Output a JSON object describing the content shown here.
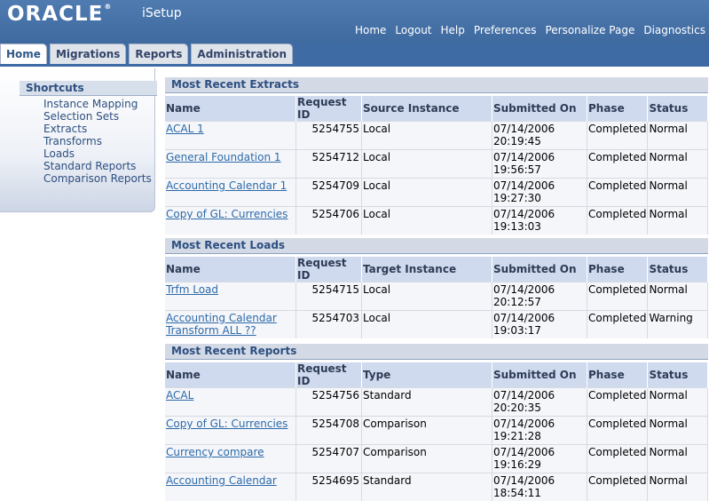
{
  "app": {
    "logo": "ORACLE",
    "subtitle": "iSetup"
  },
  "global_links": [
    "Home",
    "Logout",
    "Help",
    "Preferences",
    "Personalize Page",
    "Diagnostics"
  ],
  "tabs": [
    "Home",
    "Migrations",
    "Reports",
    "Administration"
  ],
  "sidebar": {
    "title": "Shortcuts",
    "items": [
      "Instance Mapping",
      "Selection Sets",
      "Extracts",
      "Transforms",
      "Loads",
      "Standard Reports",
      "Comparison Reports"
    ]
  },
  "extracts": {
    "title": "Most Recent Extracts",
    "headers": [
      "Name",
      "Request ID",
      "Source Instance",
      "Submitted On",
      "Phase",
      "Status"
    ],
    "rows": [
      {
        "name": "ACAL 1",
        "request_id": "5254755",
        "instance": "Local",
        "date": "07/14/2006",
        "time": "20:19:45",
        "phase": "Completed",
        "status": "Normal"
      },
      {
        "name": "General Foundation 1",
        "request_id": "5254712",
        "instance": "Local",
        "date": "07/14/2006",
        "time": "19:56:57",
        "phase": "Completed",
        "status": "Normal"
      },
      {
        "name": "Accounting Calendar 1",
        "request_id": "5254709",
        "instance": "Local",
        "date": "07/14/2006",
        "time": "19:27:30",
        "phase": "Completed",
        "status": "Normal"
      },
      {
        "name": "Copy of GL: Currencies",
        "request_id": "5254706",
        "instance": "Local",
        "date": "07/14/2006",
        "time": "19:13:03",
        "phase": "Completed",
        "status": "Normal"
      }
    ]
  },
  "loads": {
    "title": "Most Recent Loads",
    "headers": [
      "Name",
      "Request ID",
      "Target Instance",
      "Submitted On",
      "Phase",
      "Status"
    ],
    "rows": [
      {
        "name": "Trfm Load",
        "name2": "",
        "request_id": "5254715",
        "instance": "Local",
        "date": "07/14/2006",
        "time": "20:12:57",
        "phase": "Completed",
        "status": "Normal"
      },
      {
        "name": "Accounting Calendar",
        "name2": "Transform ALL ??",
        "request_id": "5254703",
        "instance": "Local",
        "date": "07/14/2006",
        "time": "19:03:17",
        "phase": "Completed",
        "status": "Warning"
      }
    ]
  },
  "reports": {
    "title": "Most Recent Reports",
    "headers": [
      "Name",
      "Request ID",
      "Type",
      "Submitted On",
      "Phase",
      "Status"
    ],
    "rows": [
      {
        "name": "ACAL",
        "request_id": "5254756",
        "type": "Standard",
        "date": "07/14/2006",
        "time": "20:20:35",
        "phase": "Completed",
        "status": "Normal"
      },
      {
        "name": "Copy of GL: Currencies",
        "request_id": "5254708",
        "type": "Comparison",
        "date": "07/14/2006",
        "time": "19:21:28",
        "phase": "Completed",
        "status": "Normal"
      },
      {
        "name": "Currency compare",
        "request_id": "5254707",
        "type": "Comparison",
        "date": "07/14/2006",
        "time": "19:16:29",
        "phase": "Completed",
        "status": "Normal"
      },
      {
        "name": "Accounting Calendar",
        "request_id": "5254695",
        "type": "Standard",
        "date": "07/14/2006",
        "time": "18:54:11",
        "phase": "Completed",
        "status": "Normal"
      }
    ]
  }
}
